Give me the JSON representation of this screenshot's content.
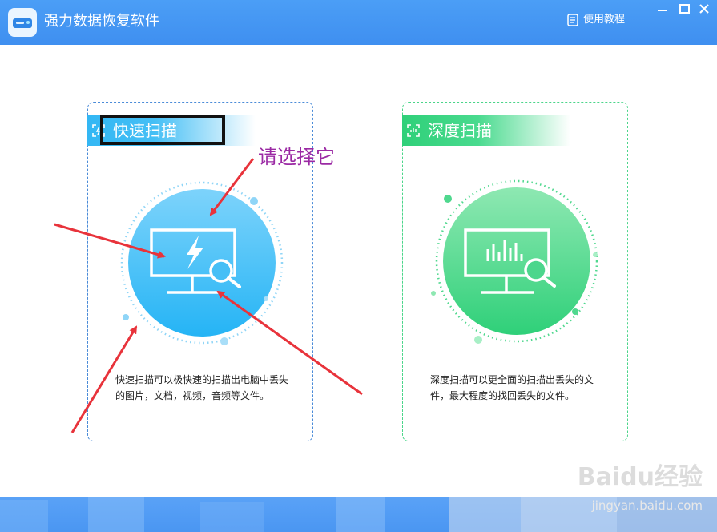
{
  "window": {
    "title": "强力数据恢复软件",
    "help_label": "使用教程"
  },
  "cards": {
    "quick": {
      "title": "快速扫描",
      "description": "快速扫描可以极快速的扫描出电脑中丢失的图片，文档，视频，音频等文件。",
      "accent": "#33b7f4",
      "icon": "monitor-lightning-search-icon"
    },
    "deep": {
      "title": "深度扫描",
      "description": "深度扫描可以更全面的扫描出丢失的文件，最大程度的找回丢失的文件。",
      "accent": "#2fd079",
      "icon": "monitor-chart-search-icon"
    }
  },
  "annotation": {
    "text": "请选择它",
    "color": "#9b2aa4",
    "arrow_color": "#e8333b"
  },
  "watermark": {
    "logo": "Baidu经验",
    "url": "jingyan.baidu.com"
  }
}
